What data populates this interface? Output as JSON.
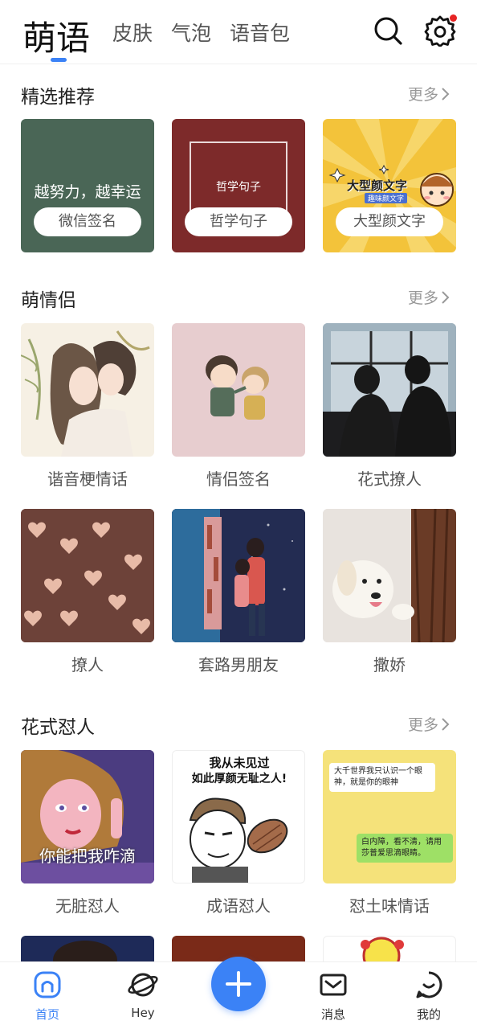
{
  "header": {
    "tabs": [
      {
        "label": "萌语",
        "active": true
      },
      {
        "label": "皮肤",
        "active": false
      },
      {
        "label": "气泡",
        "active": false
      },
      {
        "label": "语音包",
        "active": false
      }
    ],
    "icons": [
      "search-icon",
      "gear-icon"
    ],
    "accent": "#3b82f6",
    "notification_dot_color": "#e62424"
  },
  "featured": {
    "title": "精选推荐",
    "more_label": "更多",
    "cards": [
      {
        "label": "微信签名",
        "image_text": "越努力，越幸运",
        "bg": "#4a6656"
      },
      {
        "label": "哲学句子",
        "image_text": "哲学句子",
        "bg": "#7d2a2a"
      },
      {
        "label": "大型颜文字",
        "image_text": "大型颜文字",
        "image_subtext": "趣味颜文字",
        "bg": "#f3c33a"
      }
    ]
  },
  "couples": {
    "title": "萌情侣",
    "more_label": "更多",
    "cards": [
      {
        "label": "谐音梗情话"
      },
      {
        "label": "情侣签名"
      },
      {
        "label": "花式撩人"
      },
      {
        "label": "撩人"
      },
      {
        "label": "套路男朋友"
      },
      {
        "label": "撒娇"
      }
    ]
  },
  "roast": {
    "title": "花式怼人",
    "more_label": "更多",
    "cards": [
      {
        "label": "无脏怼人",
        "image_text": "你能把我咋滴"
      },
      {
        "label": "成语怼人",
        "image_text_1": "我从未见过",
        "image_text_2": "如此厚颜无耻之人!"
      },
      {
        "label": "怼土味情话",
        "bubble_1": "大千世界我只认识一个眼神，就是你的眼神",
        "bubble_2": "白内障，看不清，请用莎普爱思滴眼睛。"
      }
    ]
  },
  "bottom_nav": {
    "items": [
      {
        "label": "首页",
        "icon": "home-icon",
        "active": true
      },
      {
        "label": "Hey",
        "icon": "planet-icon",
        "active": false
      },
      {
        "label": "",
        "icon": "plus-icon",
        "active": false
      },
      {
        "label": "消息",
        "icon": "mail-icon",
        "active": false
      },
      {
        "label": "我的",
        "icon": "face-icon",
        "active": false
      }
    ]
  }
}
